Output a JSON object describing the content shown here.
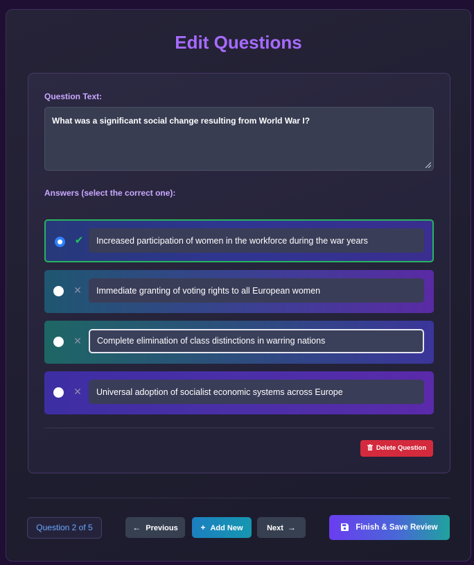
{
  "page": {
    "title": "Edit Questions"
  },
  "question": {
    "label": "Question Text:",
    "text": "What was a significant social change resulting from World War I?"
  },
  "answers_label": "Answers (select the correct one):",
  "answers": [
    {
      "text": "Increased participation of women in the workforce during the war years",
      "correct": true
    },
    {
      "text": "Immediate granting of voting rights to all European women",
      "correct": false
    },
    {
      "text": "Complete elimination of class distinctions in warring nations",
      "correct": false
    },
    {
      "text": "Universal adoption of socialist economic systems across Europe",
      "correct": false
    }
  ],
  "actions": {
    "delete_label": "Delete Question"
  },
  "footer": {
    "counter": "Question 2 of 5",
    "previous_label": "Previous",
    "add_label": "Add New",
    "next_label": "Next",
    "finish_label": "Finish & Save Review"
  },
  "colors": {
    "accent": "#a66bff",
    "correct": "#22c55e",
    "danger": "#d42a3d",
    "selected_radio": "#2f80ff"
  },
  "icons": {
    "correct_mark": "check-icon",
    "incorrect_mark": "x-icon",
    "delete": "trash-icon",
    "previous": "arrow-left-icon",
    "add": "plus-icon",
    "next": "arrow-right-icon",
    "finish": "save-icon"
  }
}
